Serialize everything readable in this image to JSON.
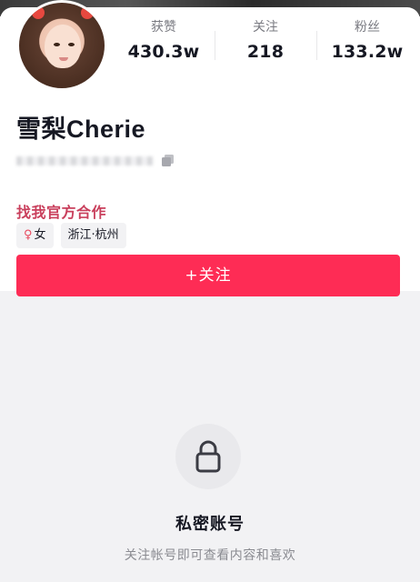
{
  "profile": {
    "name": "雪梨Cherie",
    "cooperate_link": "找我官方合作",
    "stats": [
      {
        "label": "获赞",
        "value": "430.3w"
      },
      {
        "label": "关注",
        "value": "218"
      },
      {
        "label": "粉丝",
        "value": "133.2w"
      }
    ],
    "tags": {
      "gender_icon": "female-icon",
      "gender": "女",
      "location": "浙江·杭州"
    },
    "follow_button": "+关注"
  },
  "private": {
    "icon": "lock-icon",
    "title": "私密账号",
    "subtitle": "关注帐号即可查看内容和喜欢"
  },
  "colors": {
    "accent": "#fe2c55",
    "cooperate": "#c93f5c",
    "background": "#f2f2f4"
  }
}
